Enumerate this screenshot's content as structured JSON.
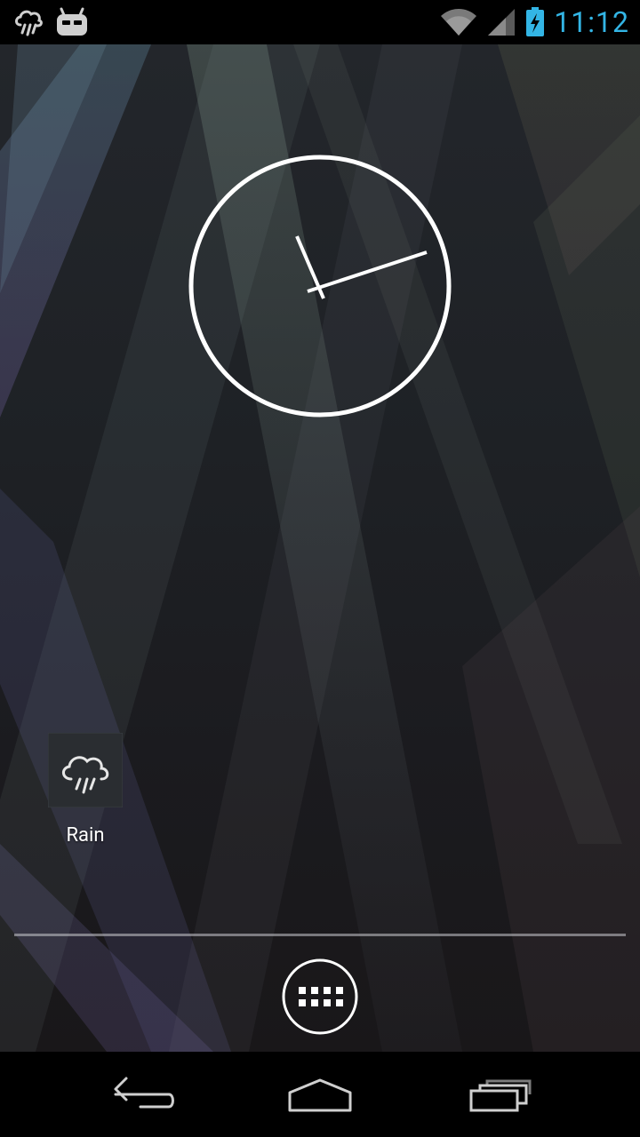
{
  "status_bar": {
    "time": "11:12",
    "notification_icons": [
      "rain-weather-icon",
      "cyanogenmod-icon"
    ],
    "system_icons": [
      "wifi-icon",
      "signal-icon",
      "battery-charging-icon"
    ],
    "time_color": "#33b5e5"
  },
  "home": {
    "widgets": [
      {
        "type": "analog-clock"
      }
    ],
    "shortcuts": [
      {
        "label": "Rain",
        "icon": "rain-cloud-icon"
      }
    ],
    "dock": {
      "app_drawer_icon": "app-drawer-icon"
    }
  },
  "navigation_bar": {
    "buttons": [
      "back-icon",
      "home-icon",
      "recent-apps-icon"
    ]
  }
}
